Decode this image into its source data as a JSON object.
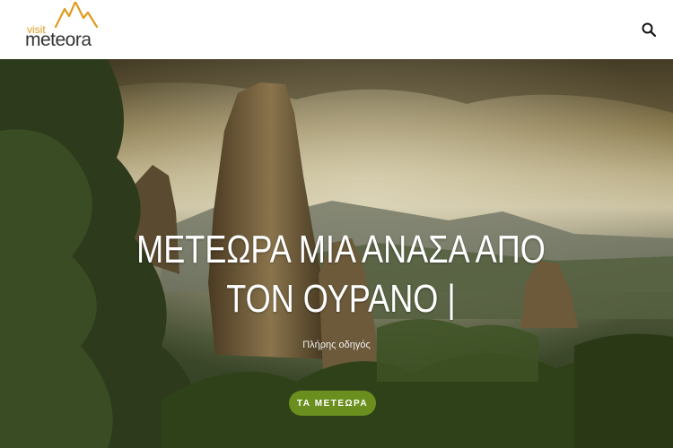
{
  "header": {
    "logo": {
      "small_text": "visit",
      "main_text": "meteora"
    },
    "search_icon": "search-icon"
  },
  "hero": {
    "title": "ΜΕΤΕΩΡΑ ΜΙΑ ΑΝΑΣΑ ΑΠΟ ΤΟΝ ΟΥΡΑΝΟ |",
    "subtitle": "Πλήρης οδηγός",
    "cta_label": "ΤΑ ΜΕΤΕΩΡΑ"
  },
  "colors": {
    "accent": "#6b8f1e",
    "logo_orange": "#e09b1e"
  }
}
